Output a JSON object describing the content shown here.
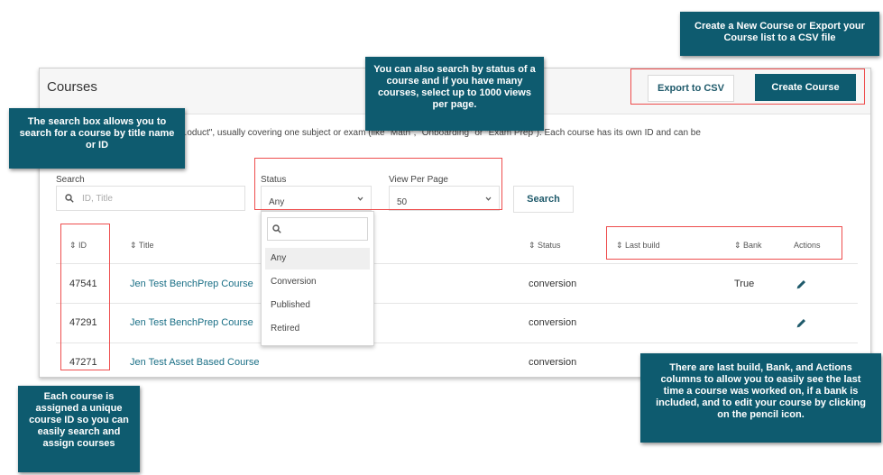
{
  "page": {
    "title": "Courses",
    "description": "...oduct\", usually covering one subject or exam (like \"Math\", \"Onboarding\" or \"Exam Prep\"). Each course has its own ID and can be"
  },
  "header": {
    "export_label": "Export to CSV",
    "create_label": "Create Course"
  },
  "filters": {
    "search_label": "Search",
    "search_placeholder": "ID, Title",
    "status_label": "Status",
    "status_value": "Any",
    "view_label": "View Per Page",
    "view_value": "50",
    "search_button": "Search"
  },
  "status_dropdown": {
    "options": [
      "Any",
      "Conversion",
      "Published",
      "Retired"
    ]
  },
  "table": {
    "columns": [
      "ID",
      "Title",
      "Status",
      "Last build",
      "Bank",
      "Actions"
    ],
    "rows": [
      {
        "id": "47541",
        "title": "Jen Test BenchPrep Course",
        "status": "conversion",
        "last_build": "",
        "bank": "True"
      },
      {
        "id": "47291",
        "title": "Jen Test BenchPrep Course",
        "status": "conversion",
        "last_build": "",
        "bank": ""
      },
      {
        "id": "47271",
        "title": "Jen Test Asset Based Course",
        "status": "conversion",
        "last_build": "",
        "bank": ""
      }
    ]
  },
  "callouts": {
    "top_right": "Create a New Course or Export your Course list to a CSV file",
    "status": "You can also search by status of a course and if you have many courses, select up to 1000 views per page.",
    "search": "The search box allows you to search for a course by title name or ID",
    "id": "Each course is assigned a unique course ID so you can easily search and assign courses",
    "columns": "There are last build, Bank, and Actions columns to allow you to easily see the last time a course was worked on, if a bank is included, and to edit your course by clicking on the pencil icon."
  },
  "colors": {
    "accent": "#0e5b6f",
    "link": "#1a6f86",
    "highlight": "#ee4d4d"
  }
}
